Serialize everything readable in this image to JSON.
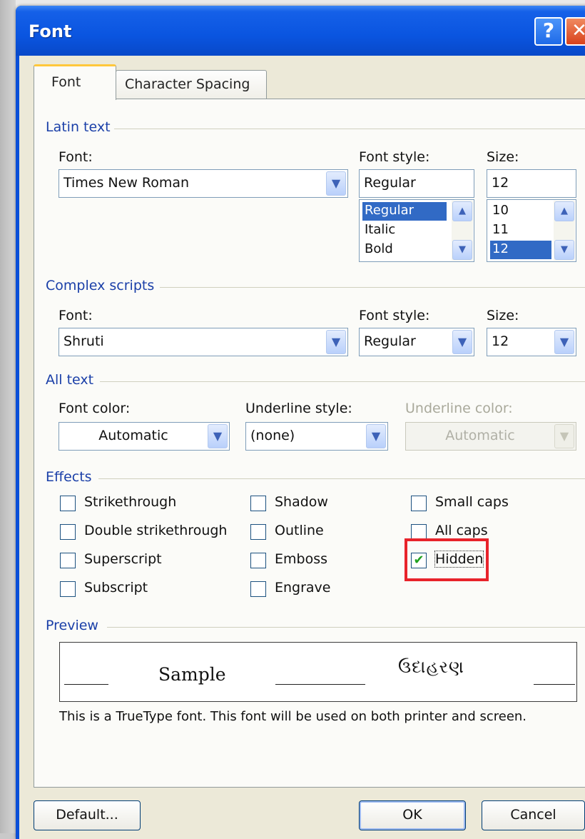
{
  "dialog": {
    "title": "Font",
    "help_glyph": "?",
    "close_glyph": "✕"
  },
  "tabs": [
    {
      "label": "Font",
      "active": true
    },
    {
      "label": "Character Spacing",
      "active": false
    }
  ],
  "latin_text": {
    "group_label": "Latin text",
    "font_label": "Font:",
    "font_value": "Times New Roman",
    "style_label": "Font style:",
    "style_value": "Regular",
    "style_options": [
      "Regular",
      "Italic",
      "Bold"
    ],
    "style_selected": "Regular",
    "size_label": "Size:",
    "size_value": "12",
    "size_options": [
      "10",
      "11",
      "12"
    ],
    "size_selected": "12"
  },
  "complex_scripts": {
    "group_label": "Complex scripts",
    "font_label": "Font:",
    "font_value": "Shruti",
    "style_label": "Font style:",
    "style_value": "Regular",
    "size_label": "Size:",
    "size_value": "12"
  },
  "all_text": {
    "group_label": "All text",
    "color_label": "Font color:",
    "color_value": "Automatic",
    "underline_label": "Underline style:",
    "underline_value": "(none)",
    "underline_color_label": "Underline color:",
    "underline_color_value": "Automatic"
  },
  "effects": {
    "group_label": "Effects",
    "items": [
      {
        "label": "Strikethrough",
        "checked": false
      },
      {
        "label": "Double strikethrough",
        "checked": false
      },
      {
        "label": "Superscript",
        "checked": false
      },
      {
        "label": "Subscript",
        "checked": false
      },
      {
        "label": "Shadow",
        "checked": false
      },
      {
        "label": "Outline",
        "checked": false
      },
      {
        "label": "Emboss",
        "checked": false
      },
      {
        "label": "Engrave",
        "checked": false
      },
      {
        "label": "Small caps",
        "checked": false
      },
      {
        "label": "All caps",
        "checked": false
      },
      {
        "label": "Hidden",
        "checked": true
      }
    ],
    "check_glyph": "✔"
  },
  "preview": {
    "group_label": "Preview",
    "sample_text": "Sample",
    "complex_sample_text": "ઉદાહરણ",
    "note": "This is a TrueType font. This font will be used on both printer and screen."
  },
  "buttons": {
    "default_label": "Default...",
    "ok_label": "OK",
    "cancel_label": "Cancel"
  },
  "icons": {
    "dropdown": "▼",
    "scroll_up": "▲",
    "scroll_down": "▼"
  },
  "colors": {
    "titlebar": "#0a55e0",
    "selection": "#316ac5",
    "highlight_box": "#e8232b",
    "group_label": "#1a3fa8"
  }
}
